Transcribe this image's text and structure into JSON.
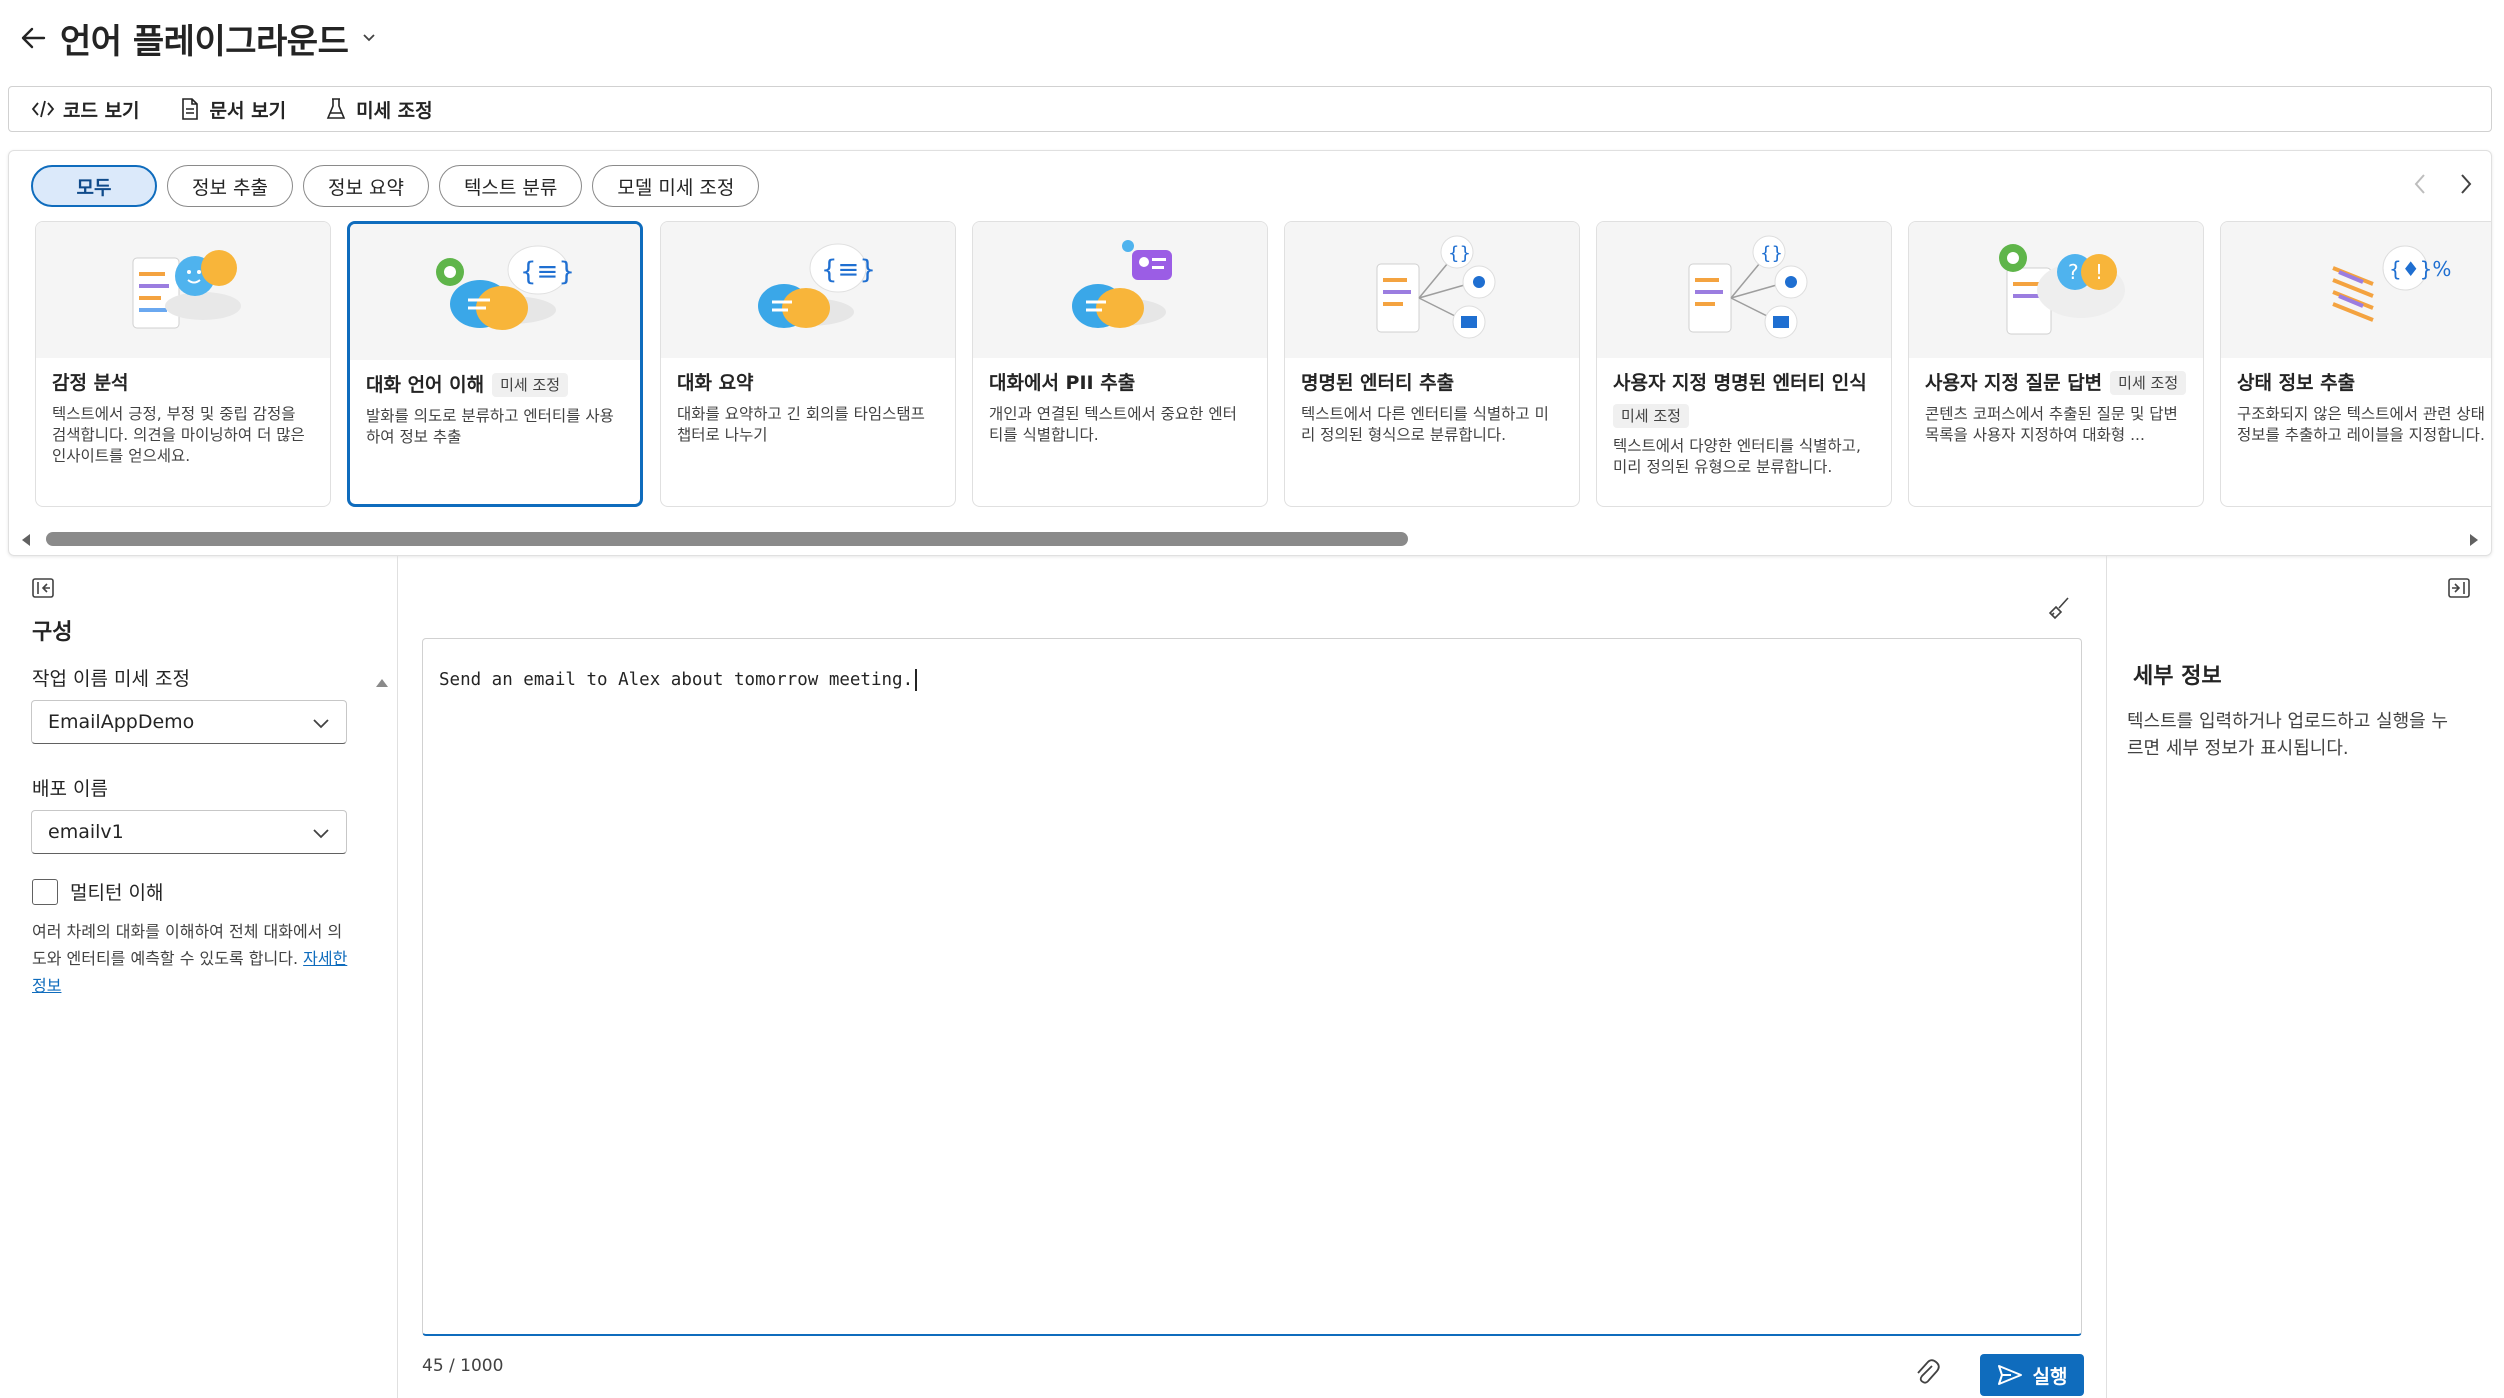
{
  "header": {
    "title": "언어 플레이그라운드"
  },
  "toolbar": {
    "code": "코드 보기",
    "docs": "문서 보기",
    "finetune": "미세 조정"
  },
  "filters": [
    "모두",
    "정보 추출",
    "정보 요약",
    "텍스트 분류",
    "모델 미세 조정"
  ],
  "cards": [
    {
      "title": "감정 분석",
      "badge": "",
      "desc": "텍스트에서 긍정, 부정 및 중립 감정을 검색합니다. 의견을 마이닝하여 더 많은 인사이트를 얻으세요.",
      "icon": "sentiment-icon"
    },
    {
      "title": "대화 언어 이해",
      "badge": "미세 조정",
      "desc": "발화를 의도로 분류하고 엔터티를 사용하여 정보 추출",
      "icon": "conversation-icon"
    },
    {
      "title": "대화 요약",
      "badge": "",
      "desc": "대화를 요약하고 긴 회의를 타임스탬프 챕터로 나누기",
      "icon": "summary-icon"
    },
    {
      "title": "대화에서 PII 추출",
      "badge": "",
      "desc": "개인과 연결된 텍스트에서 중요한 엔터티를 식별합니다.",
      "icon": "pii-icon"
    },
    {
      "title": "명명된 엔터티 추출",
      "badge": "",
      "desc": "텍스트에서 다른 엔터티를 식별하고 미리 정의된 형식으로 분류합니다.",
      "icon": "ner-icon"
    },
    {
      "title": "사용자 지정 명명된 엔터티 인식",
      "badge": "미세 조정",
      "desc": "텍스트에서 다양한 엔터티를 식별하고, 미리 정의된 유형으로 분류합니다.",
      "icon": "custom-ner-icon"
    },
    {
      "title": "사용자 지정 질문 답변",
      "badge": "미세 조정",
      "desc": "콘텐츠 코퍼스에서 추출된 질문 및 답변 목록을 사용자 지정하여 대화형 ...",
      "icon": "qa-icon"
    },
    {
      "title": "상태 정보 추출",
      "badge": "",
      "desc": "구조화되지 않은 텍스트에서 관련 상태 정보를 추출하고 레이블을 지정합니다.",
      "icon": "health-icon"
    }
  ],
  "config": {
    "title": "구성",
    "task_label": "작업 이름 미세 조정",
    "task_value": "EmailAppDemo",
    "deploy_label": "배포 이름",
    "deploy_value": "emailv1",
    "multiturn_label": "멀티턴 이해",
    "multiturn_checked": false,
    "help_text": "여러 차례의 대화를 이해하여 전체 대화에서 의도와 엔터티를 예측할 수 있도록 합니다.",
    "help_link": "자세한 정보"
  },
  "input": {
    "text": "Send an email to Alex about tomorrow meeting.",
    "counter": "45 / 1000",
    "run_label": "실행"
  },
  "details": {
    "title": "세부 정보",
    "text": "텍스트를 입력하거나 업로드하고 실행을 누르면 세부 정보가 표시됩니다."
  },
  "colors": {
    "accent": "#0f6cbd",
    "selected_pill_bg": "#dbe9fa"
  }
}
